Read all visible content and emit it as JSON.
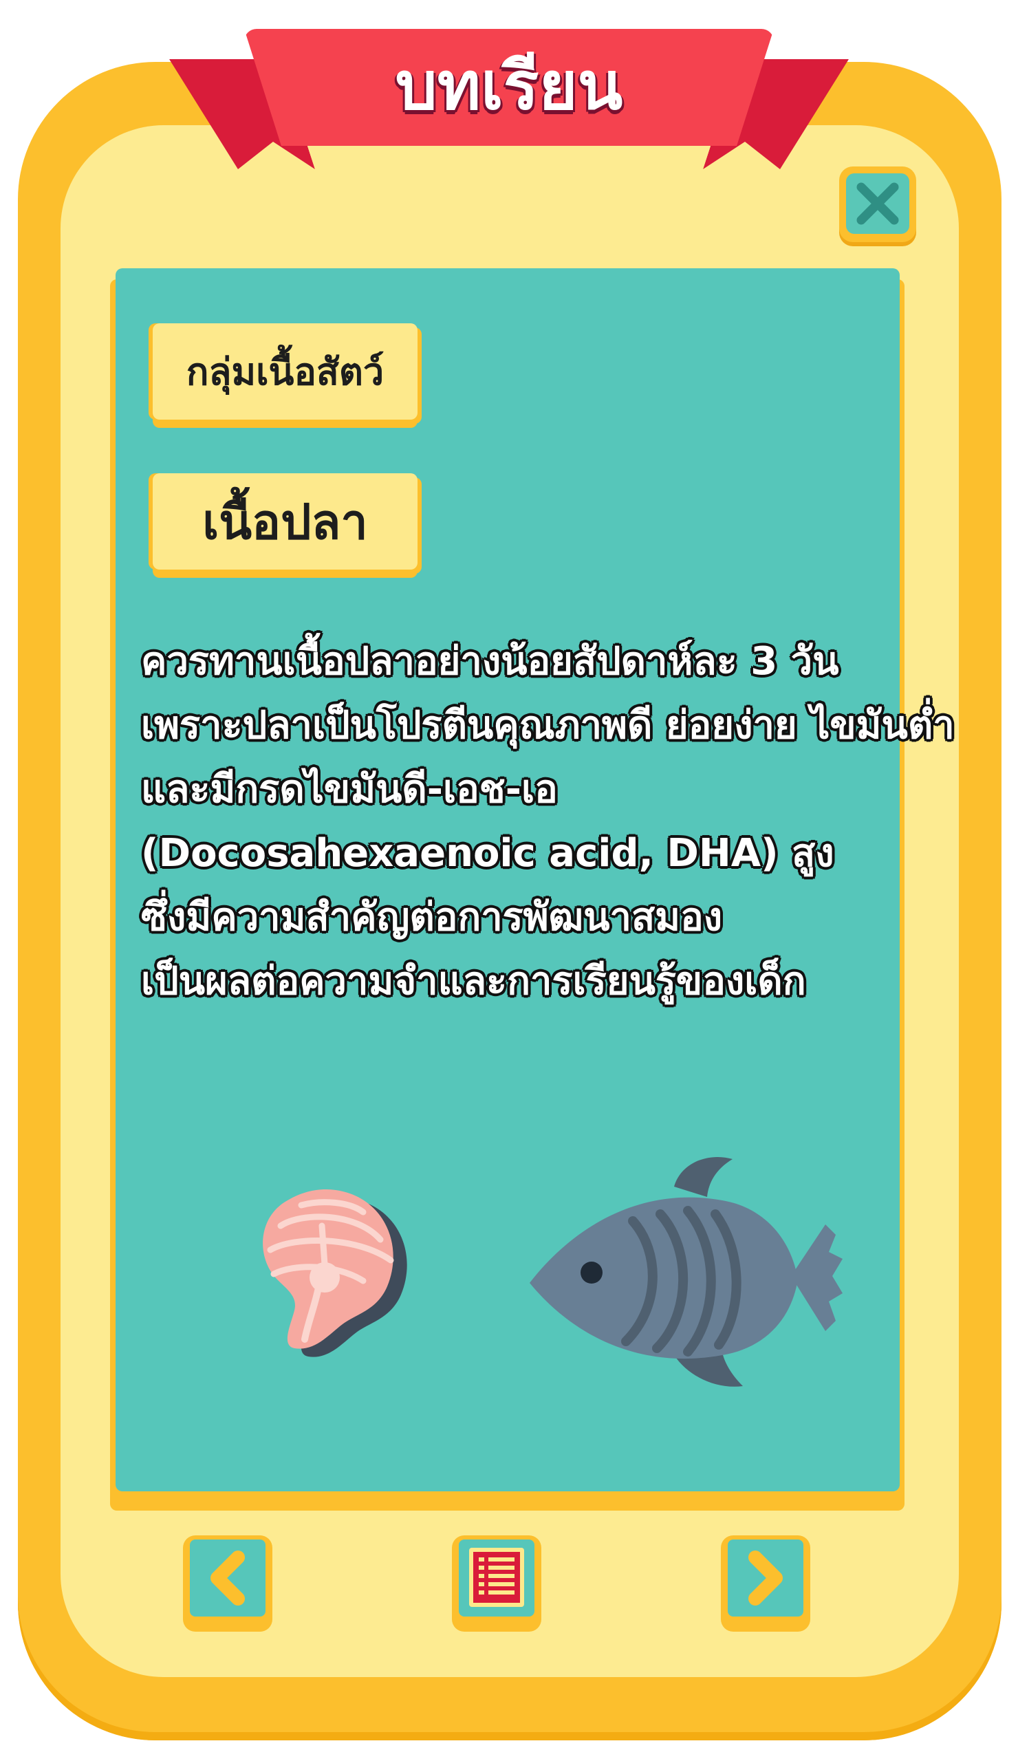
{
  "header": {
    "title": "บทเรียน"
  },
  "close_button": {
    "icon": "close-icon",
    "color": "#2f8f84"
  },
  "lesson": {
    "category": "กลุ่มเนื้อสัตว์",
    "food": "เนื้อปลา",
    "description_lines": [
      "ควรทานเนื้อปลาอย่างน้อยสัปดาห์ละ 3 วัน",
      "เพราะปลาเป็นโปรตีนคุณภาพดี ย่อยง่าย ไขมันต่ำ",
      "และมีกรดไขมันดี-เอช-เอ",
      "(Docosahexaenoic acid, DHA) สูง",
      "ซึ่งมีความสำคัญต่อการพัฒนาสมอง",
      "เป็นผลต่อความจำและการเรียนรู้ของเด็ก"
    ],
    "illustrations": [
      "salmon-steak-icon",
      "fish-icon"
    ]
  },
  "navigation": {
    "prev_icon": "chevron-left-icon",
    "menu_icon": "list-icon",
    "next_icon": "chevron-right-icon"
  },
  "colors": {
    "frame": "#fcbf2d",
    "inner": "#fdeb91",
    "panel": "#56c6ba",
    "ribbon": "#f5424f",
    "label": "#fde98c"
  }
}
